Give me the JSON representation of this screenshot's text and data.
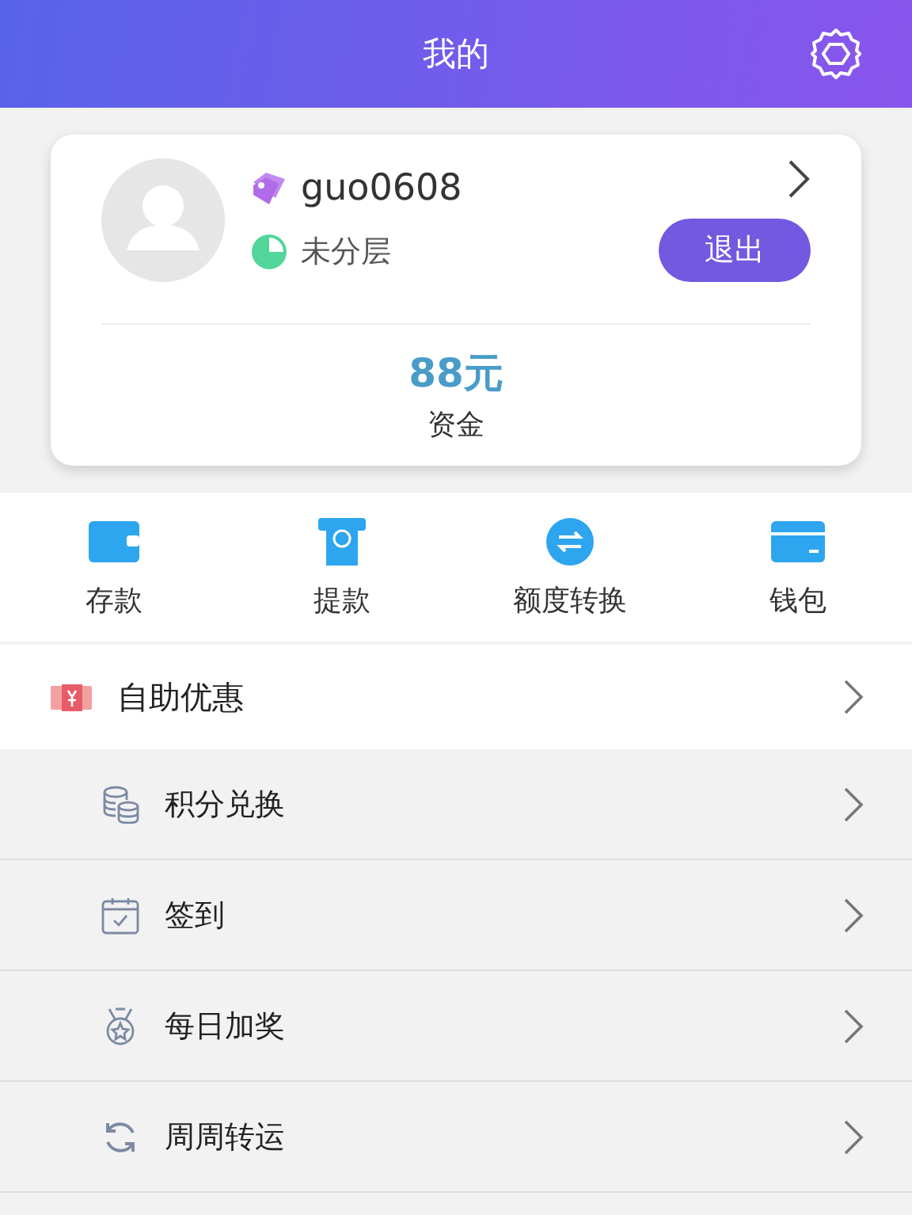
{
  "header": {
    "title": "我的"
  },
  "profile": {
    "username": "guo0608",
    "tier": "未分层",
    "logout_label": "退出",
    "balance": "88元",
    "balance_label": "资金"
  },
  "quick_actions": [
    {
      "kind": "wallet",
      "label": "存款"
    },
    {
      "kind": "atm",
      "label": "提款"
    },
    {
      "kind": "transfer",
      "label": "额度转换"
    },
    {
      "kind": "card",
      "label": "钱包"
    }
  ],
  "menu": {
    "label": "自助优惠",
    "children": [
      {
        "kind": "coins",
        "label": "积分兑换"
      },
      {
        "kind": "calendar",
        "label": "签到"
      },
      {
        "kind": "medal",
        "label": "每日加奖"
      },
      {
        "kind": "refresh",
        "label": "周周转运"
      }
    ]
  }
}
